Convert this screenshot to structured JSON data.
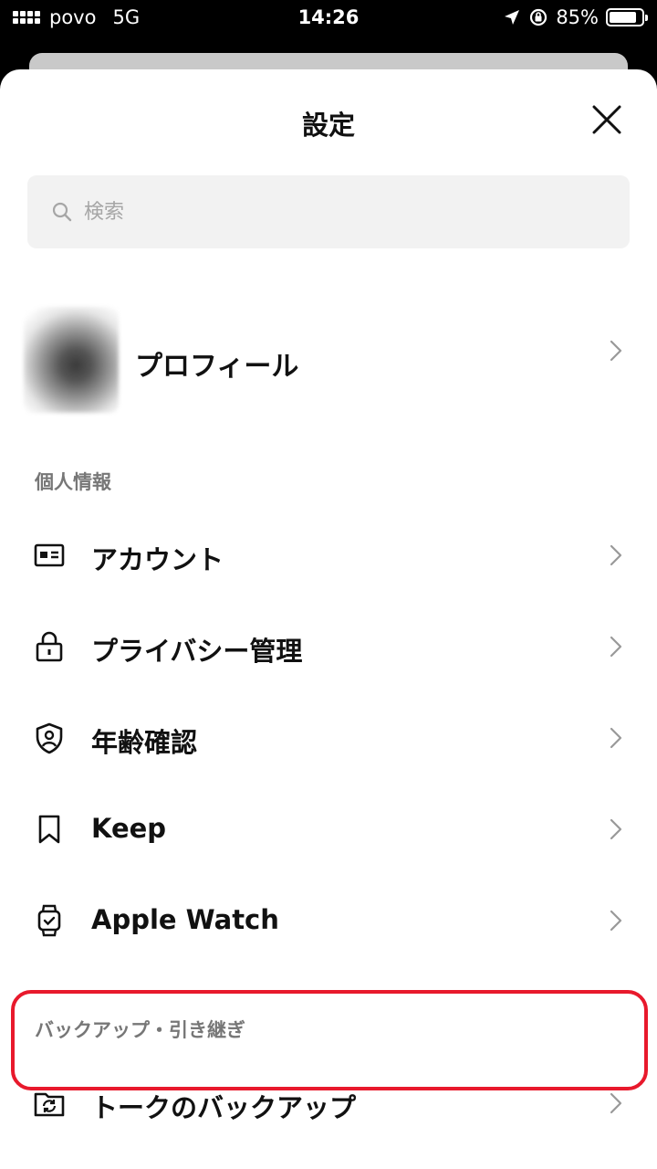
{
  "status_bar": {
    "carrier": "povo",
    "network": "5G",
    "time": "14:26",
    "battery": "85%",
    "battery_level": 0.85
  },
  "header": {
    "title": "設定"
  },
  "search": {
    "placeholder": "検索"
  },
  "profile": {
    "label": "プロフィール"
  },
  "sections": {
    "personal": "個人情報",
    "backup": "バックアップ・引き継ぎ"
  },
  "items": {
    "account": "アカウント",
    "privacy": "プライバシー管理",
    "age": "年齢確認",
    "keep": "Keep",
    "watch": "Apple Watch",
    "talk_backup": "トークのバックアップ"
  },
  "colors": {
    "highlight": "#e8192c",
    "text": "#111111",
    "secondary": "#777777"
  }
}
